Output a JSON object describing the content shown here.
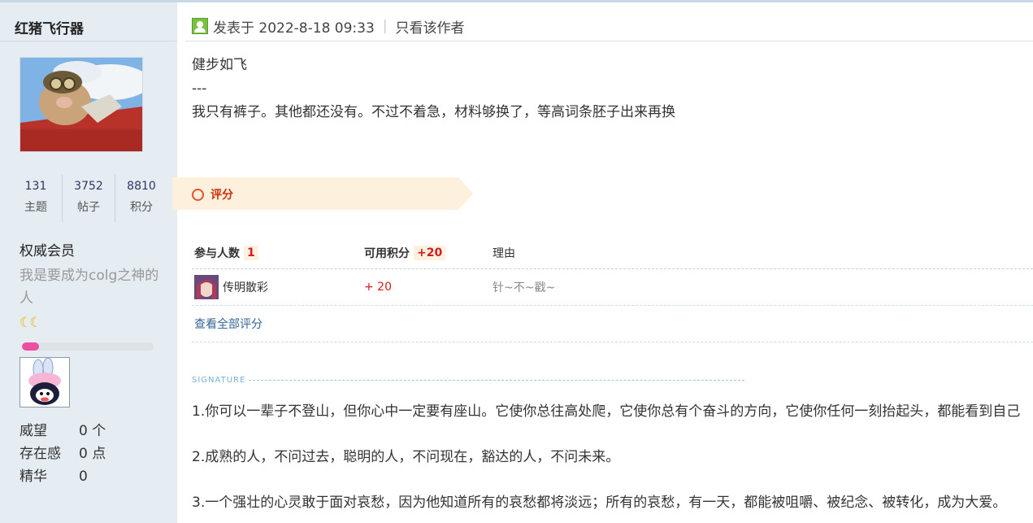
{
  "author": {
    "name": "红猪飞行器",
    "stats": [
      {
        "value": "131",
        "label": "主题"
      },
      {
        "value": "3752",
        "label": "帖子"
      },
      {
        "value": "8810",
        "label": "积分"
      }
    ],
    "group": "权威会员",
    "custom_title": "我是要成为colg之神的人",
    "level_icons": "☾☾",
    "level_progress": 0.13,
    "info": [
      {
        "label": "威望",
        "value": "0 个"
      },
      {
        "label": "存在感",
        "value": "0 点"
      },
      {
        "label": "精华",
        "value": "0"
      }
    ]
  },
  "post": {
    "posted_at": "发表于 2022-8-18 09:33",
    "separator": "|",
    "only_author": "只看该作者",
    "lines": [
      "健步如飞",
      "---",
      "我只有裤子。其他都还没有。不过不着急，材料够换了，等高词条胚子出来再换"
    ]
  },
  "rating": {
    "title": "评分",
    "head_participants": "参与人数",
    "participants": "1",
    "head_points": "可用积分",
    "points_total": "+20",
    "head_reason": "理由",
    "rows": [
      {
        "user": "传明散彩",
        "points": "+ 20",
        "reason": "针~不~戳~"
      }
    ],
    "view_all": "查看全部评分"
  },
  "signature": {
    "title": "SIGNATURE",
    "lines": [
      "1.你可以一辈子不登山，但你心中一定要有座山。它使你总往高处爬，它使你总有个奋斗的方向，它使你任何一刻抬起头，都能看到自己",
      "2.成熟的人，不问过去，聪明的人，不问现在，豁达的人，不问未来。",
      "3.一个强壮的心灵敢于面对哀愁，因为他知道所有的哀愁都将淡远；所有的哀愁，有一天，都能被咀嚼、被纪念、被转化，成为大爱。"
    ]
  },
  "colors": {
    "sidebar_bg": "#e5edf2",
    "accent_red": "#d01c1c",
    "link": "#336699",
    "rate_tab_bg": "#fdf0dc"
  }
}
